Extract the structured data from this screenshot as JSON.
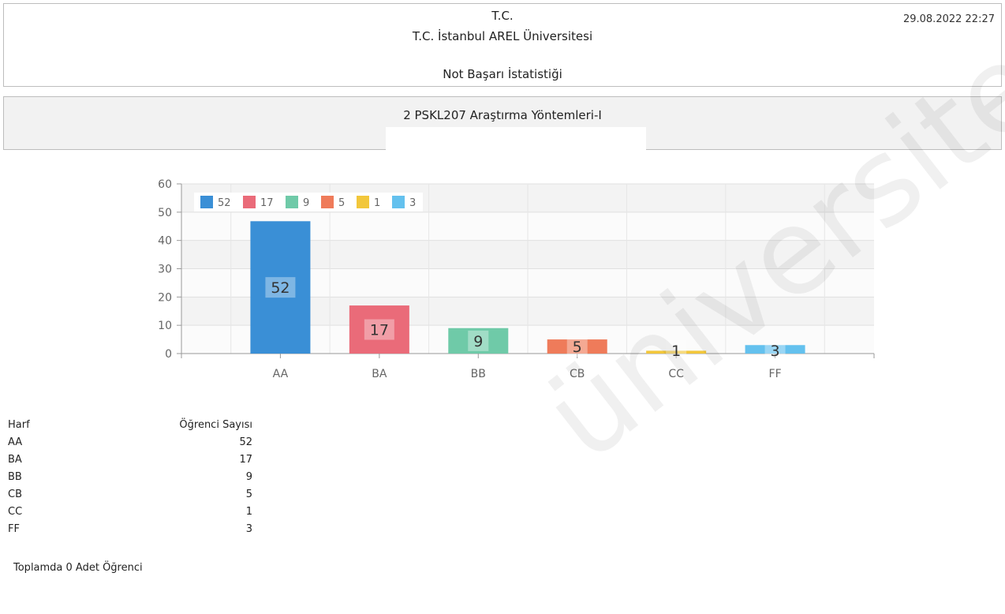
{
  "header": {
    "line1": "T.C.",
    "line2": "T.C. İstanbul AREL Üniversitesi",
    "line3": "Not Başarı İstatistiği",
    "date": "29.08.2022 22:27"
  },
  "course": {
    "title": "2 PSKL207 Araştırma Yöntemleri-I"
  },
  "chart_data": {
    "type": "bar",
    "categories": [
      "AA",
      "BA",
      "BB",
      "CB",
      "CC",
      "FF"
    ],
    "values": [
      52,
      17,
      9,
      5,
      1,
      3
    ],
    "colors": [
      "#3a8fd6",
      "#ea6b79",
      "#6fcaa8",
      "#ef7b5a",
      "#f2c73b",
      "#64c1ee"
    ],
    "legend": [
      "52",
      "17",
      "9",
      "5",
      "1",
      "3"
    ],
    "legend_position": "top-left",
    "ylim": [
      0,
      60
    ],
    "yticks": [
      0,
      10,
      20,
      30,
      40,
      50,
      60
    ],
    "grid": true,
    "title": "",
    "xlabel": "",
    "ylabel": ""
  },
  "table": {
    "headers": [
      "Harf",
      "Öğrenci Sayısı"
    ],
    "rows": [
      [
        "AA",
        "52"
      ],
      [
        "BA",
        "17"
      ],
      [
        "BB",
        "9"
      ],
      [
        "CB",
        "5"
      ],
      [
        "CC",
        "1"
      ],
      [
        "FF",
        "3"
      ]
    ],
    "total": "Toplamda 0 Adet Öğrenci"
  }
}
